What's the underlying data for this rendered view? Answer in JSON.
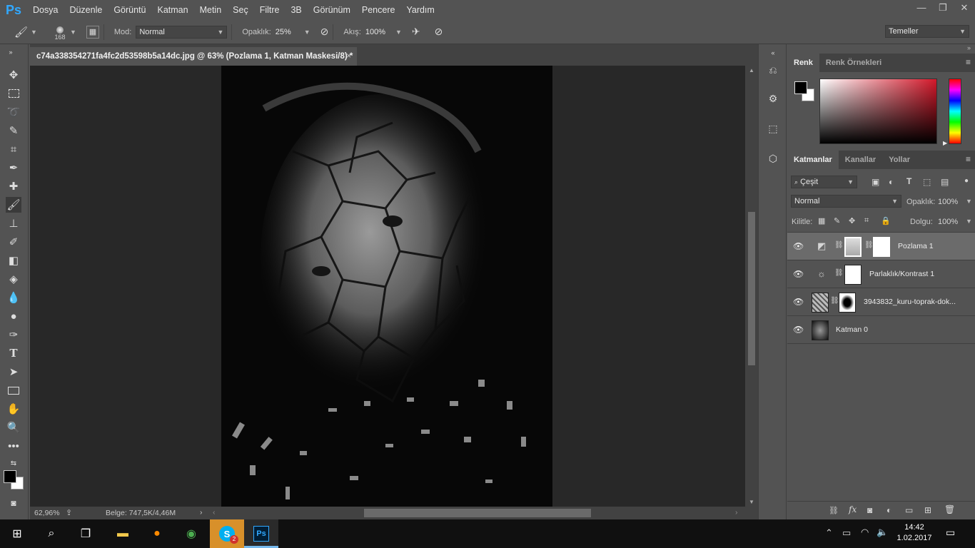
{
  "app": {
    "logo": "Ps"
  },
  "menu": [
    "Dosya",
    "Düzenle",
    "Görüntü",
    "Katman",
    "Metin",
    "Seç",
    "Filtre",
    "3B",
    "Görünüm",
    "Pencere",
    "Yardım"
  ],
  "window_controls": [
    "—",
    "❐",
    "✕"
  ],
  "options": {
    "brush_size": "168",
    "mode_label": "Mod:",
    "mode_value": "Normal",
    "opacity_label": "Opaklık:",
    "opacity_value": "25%",
    "flow_label": "Akış:",
    "flow_value": "100%",
    "workspace": "Temeller"
  },
  "document": {
    "tab_title": "c74a338354271fa4fc2d53598b5a14dc.jpg @ 63% (Pozlama 1, Katman Maskesi/8) *",
    "close": "×",
    "zoom": "62,96%",
    "doc_info": "Belge: 747,5K/4,46M"
  },
  "color_panel": {
    "tabs": [
      "Renk",
      "Renk Örnekleri"
    ],
    "foreground": "#000000",
    "background": "#ffffff"
  },
  "layers_panel": {
    "tabs": [
      "Katmanlar",
      "Kanallar",
      "Yollar"
    ],
    "filter_kind": "Çeşit",
    "blend_mode": "Normal",
    "opacity_label": "Opaklık:",
    "opacity_value": "100%",
    "lock_label": "Kilitle:",
    "fill_label": "Dolgu:",
    "fill_value": "100%",
    "layers": [
      {
        "name": "Pozlama 1",
        "selected": true
      },
      {
        "name": "Parlaklık/Kontrast 1",
        "selected": false
      },
      {
        "name": "3943832_kuru-toprak-dok...",
        "selected": false
      },
      {
        "name": "Katman 0",
        "selected": false
      }
    ]
  },
  "taskbar": {
    "time": "14:42",
    "date": "1.02.2017",
    "skype_badge": "2"
  }
}
